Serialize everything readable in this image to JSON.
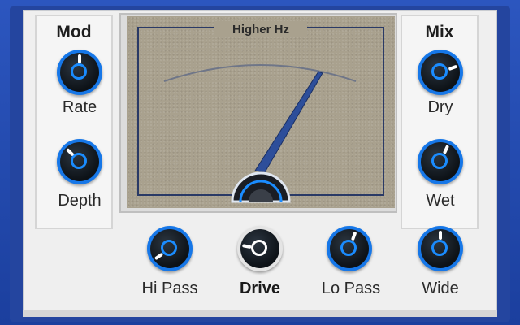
{
  "meter": {
    "title": "Higher Hz"
  },
  "mod": {
    "title": "Mod",
    "rate_label": "Rate",
    "depth_label": "Depth"
  },
  "mix": {
    "title": "Mix",
    "dry_label": "Dry",
    "wet_label": "Wet"
  },
  "bottom": {
    "hipass_label": "Hi Pass",
    "drive_label": "Drive",
    "lopass_label": "Lo Pass",
    "wide_label": "Wide"
  },
  "colors": {
    "frame": "#1f44a8",
    "knob_ring": "#1677e8",
    "meter_face": "#a9a18e",
    "needle": "#2d4e9a"
  },
  "icons": {
    "knob": "rotary-knob"
  }
}
